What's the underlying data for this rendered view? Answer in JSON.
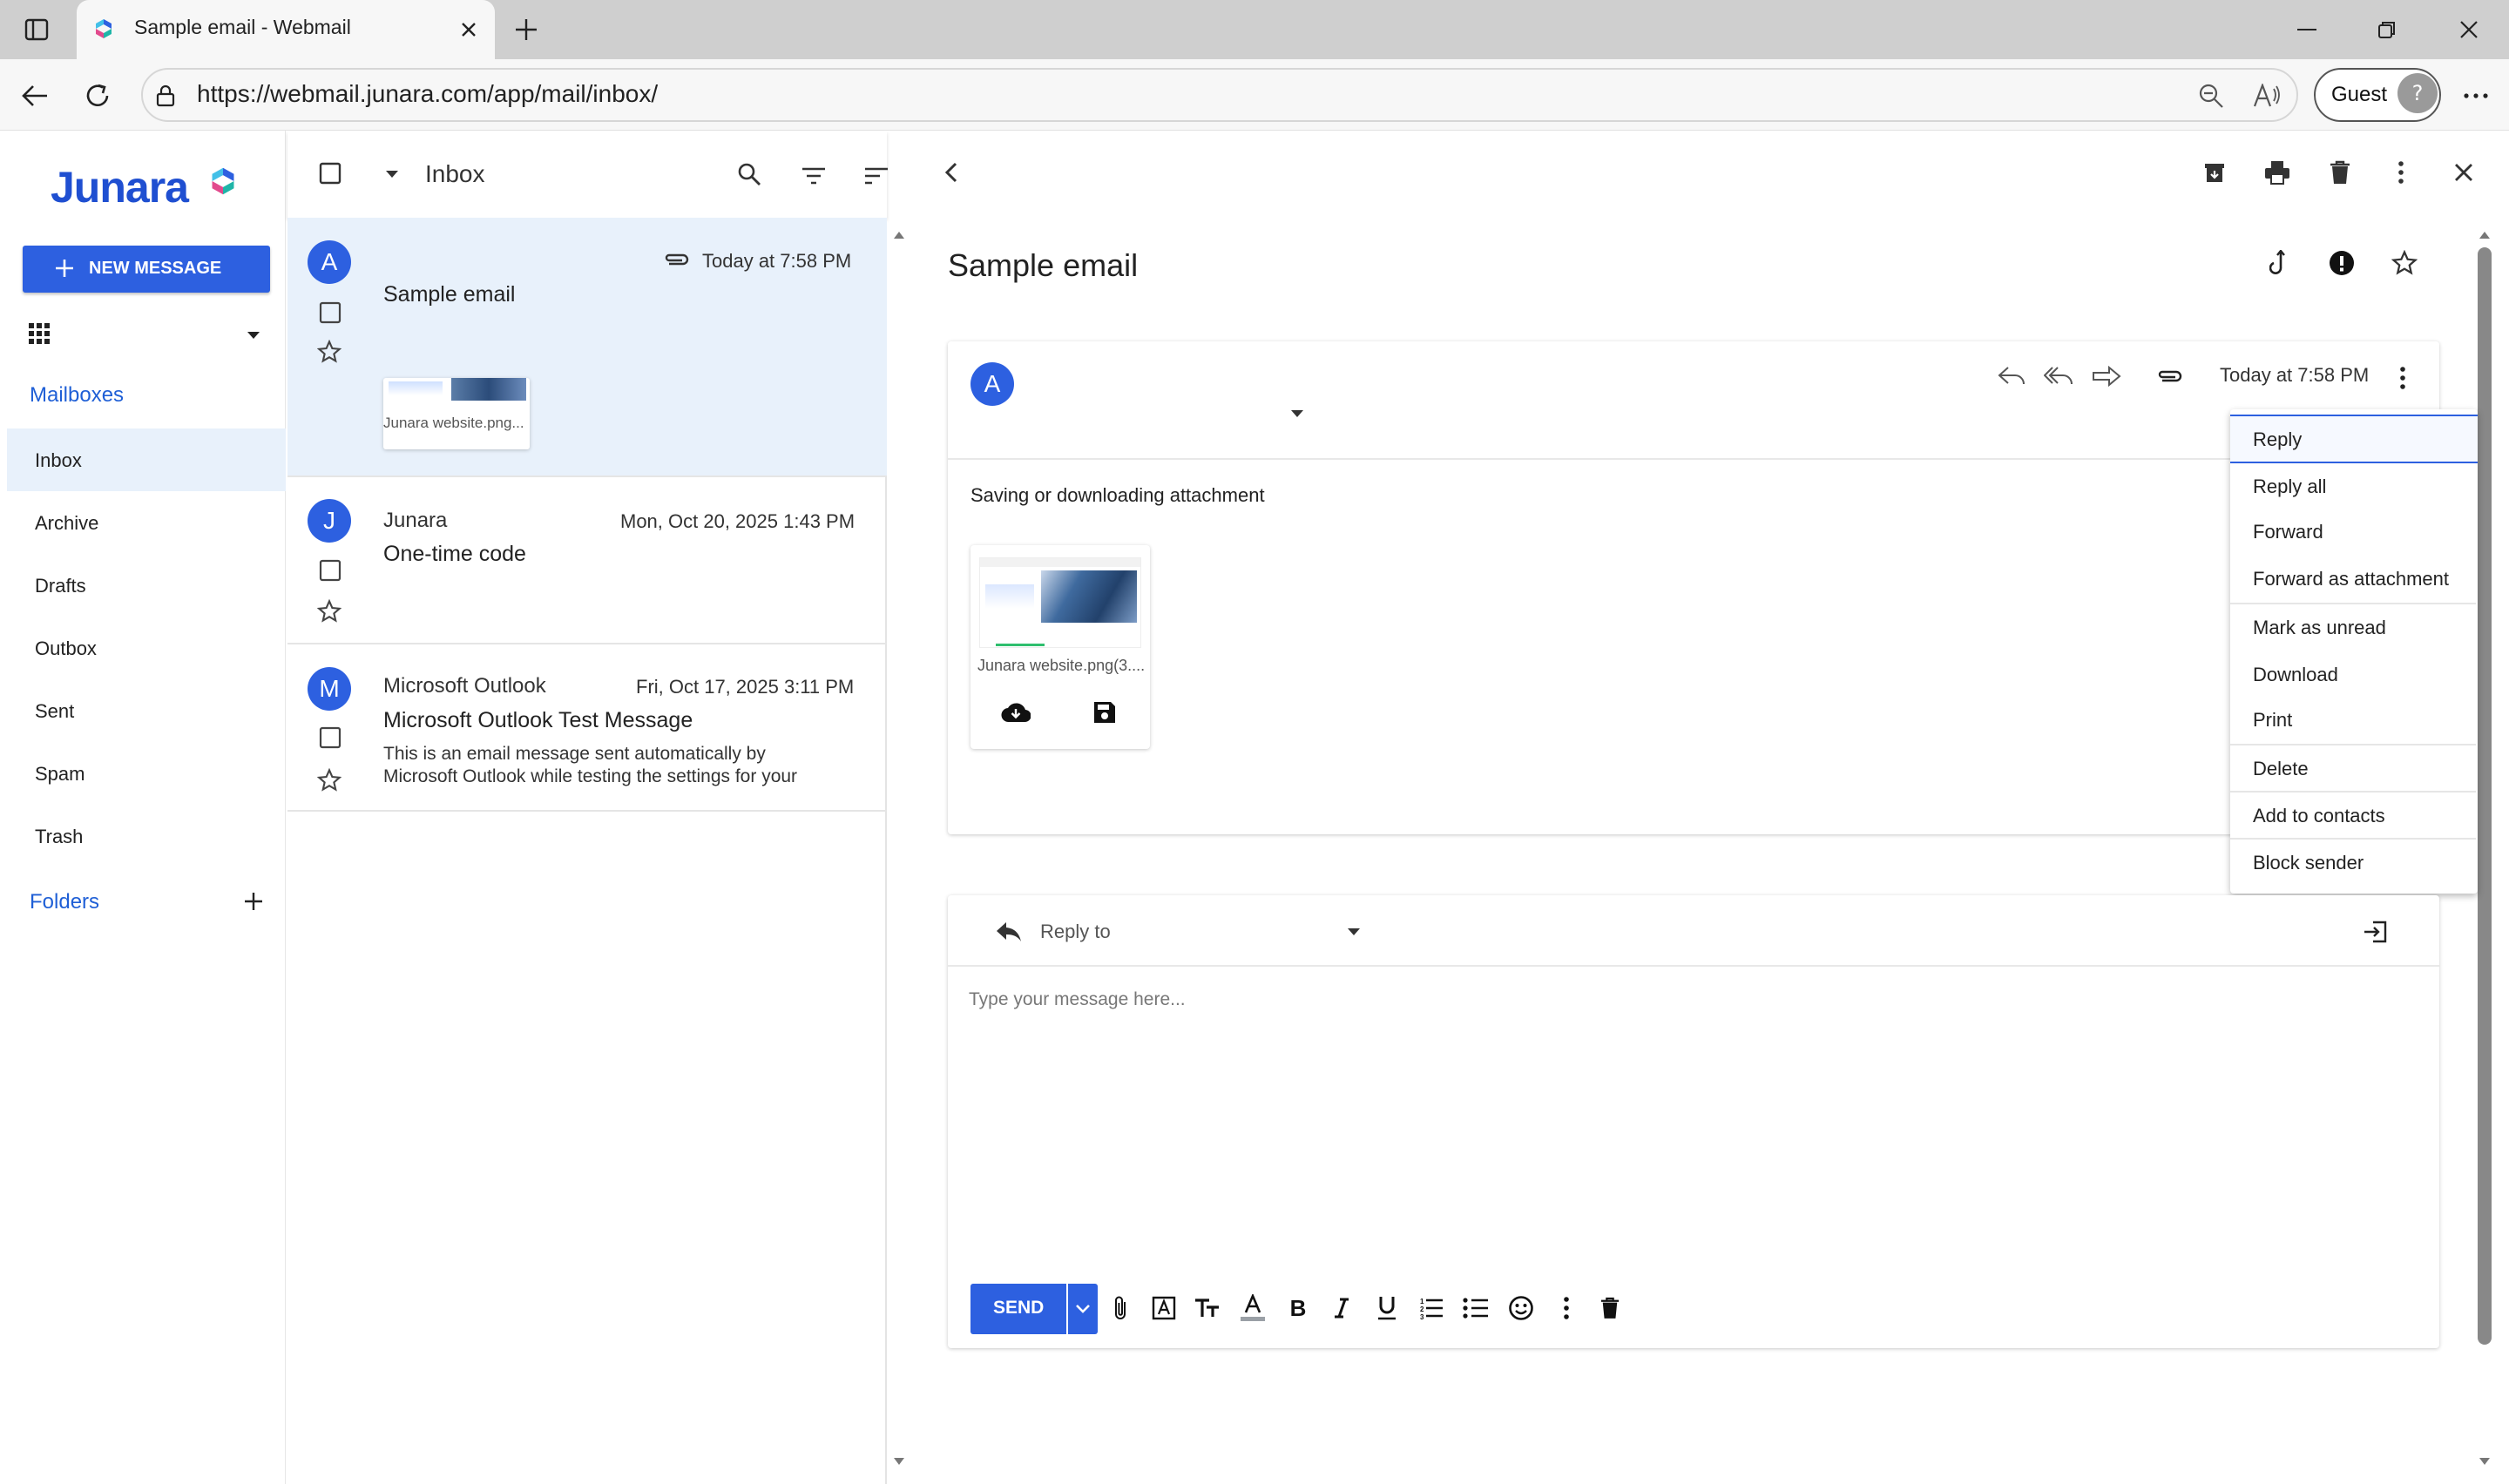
{
  "browser": {
    "tab_title": "Sample email - Webmail",
    "url": "https://webmail.junara.com/app/mail/inbox/",
    "profile_label": "Guest"
  },
  "sidebar": {
    "logo_text": "Junara",
    "new_message_label": "NEW MESSAGE",
    "mailboxes_heading": "Mailboxes",
    "mailboxes": [
      "Inbox",
      "Archive",
      "Drafts",
      "Outbox",
      "Sent",
      "Spam",
      "Trash"
    ],
    "folders_heading": "Folders"
  },
  "list": {
    "folder_title": "Inbox",
    "messages": [
      {
        "avatar": "A",
        "sender": "",
        "date": "Today at 7:58 PM",
        "subject": "Sample email",
        "preview": "",
        "attachment_name": "Junara website.png..."
      },
      {
        "avatar": "J",
        "sender": "Junara",
        "date": "Mon, Oct 20, 2025 1:43 PM",
        "subject": "One-time code",
        "preview": ""
      },
      {
        "avatar": "M",
        "sender": "Microsoft Outlook",
        "date": "Fri, Oct 17, 2025 3:11 PM",
        "subject": "Microsoft Outlook Test Message",
        "preview_line1": "This is an email message sent automatically by",
        "preview_line2": "Microsoft Outlook while testing the settings for your"
      }
    ]
  },
  "message": {
    "subject": "Sample email",
    "avatar": "A",
    "date": "Today at 7:58 PM",
    "body": "Saving or downloading attachment",
    "attachment_name": "Junara website.png(3...."
  },
  "context_menu": {
    "items": [
      "Reply",
      "Reply all",
      "Forward",
      "Forward as attachment",
      "Mark as unread",
      "Download",
      "Print",
      "Delete",
      "Add to contacts",
      "Block sender"
    ]
  },
  "reply": {
    "mode_label": "Reply to",
    "placeholder": "Type your message here...",
    "send_label": "SEND"
  },
  "colors": {
    "accent": "#2d60e0",
    "selected_row": "#e8f1fb",
    "heading_blue": "#1f5fd6"
  }
}
